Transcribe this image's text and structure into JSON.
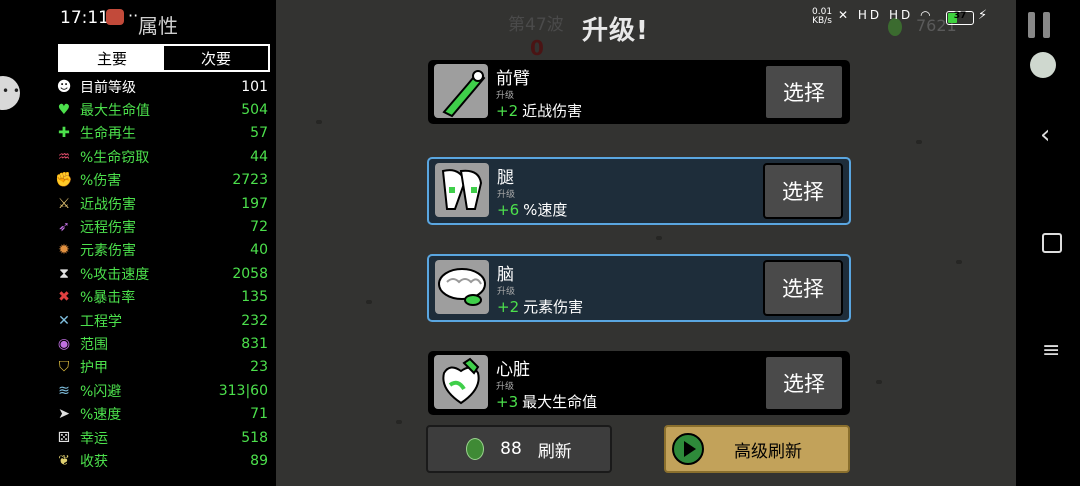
{
  "status_bar": {
    "time": "17:11",
    "more": "··",
    "net_speed": "0.01\nKB/s",
    "signal": "HD HD",
    "battery": "37"
  },
  "hud": {
    "wave": "第47波",
    "wave_counter": "0",
    "level_up_title": "升级!",
    "materials": "7621"
  },
  "stats_panel": {
    "title": "属性",
    "tabs": {
      "primary": "主要",
      "secondary": "次要"
    },
    "stats": [
      {
        "icon": "level-icon",
        "glyph": "☻",
        "color": "#ffffff",
        "name": "目前等级",
        "value": "101",
        "green": false
      },
      {
        "icon": "heart-icon",
        "glyph": "♥",
        "color": "#4ce04c",
        "name": "最大生命值",
        "value": "504",
        "green": true
      },
      {
        "icon": "regen-icon",
        "glyph": "✚",
        "color": "#4ce04c",
        "name": "生命再生",
        "value": "57",
        "green": true
      },
      {
        "icon": "lifesteal-icon",
        "glyph": "♒",
        "color": "#e04c6a",
        "name": "%生命窃取",
        "value": "44",
        "green": true
      },
      {
        "icon": "damage-icon",
        "glyph": "✊",
        "color": "#e05050",
        "name": "%伤害",
        "value": "2723",
        "green": true
      },
      {
        "icon": "melee-icon",
        "glyph": "⚔",
        "color": "#e0c070",
        "name": "近战伤害",
        "value": "197",
        "green": true
      },
      {
        "icon": "ranged-icon",
        "glyph": "➶",
        "color": "#c070e0",
        "name": "远程伤害",
        "value": "72",
        "green": true
      },
      {
        "icon": "elemental-icon",
        "glyph": "✹",
        "color": "#e09040",
        "name": "元素伤害",
        "value": "40",
        "green": true
      },
      {
        "icon": "attack-speed-icon",
        "glyph": "⧗",
        "color": "#e0e0e0",
        "name": "%攻击速度",
        "value": "2058",
        "green": true
      },
      {
        "icon": "crit-icon",
        "glyph": "✖",
        "color": "#e04040",
        "name": "%暴击率",
        "value": "135",
        "green": true
      },
      {
        "icon": "engineering-icon",
        "glyph": "✕",
        "color": "#80c0e0",
        "name": "工程学",
        "value": "232",
        "green": true
      },
      {
        "icon": "range-icon",
        "glyph": "◉",
        "color": "#c070e0",
        "name": "范围",
        "value": "831",
        "green": true
      },
      {
        "icon": "armor-icon",
        "glyph": "⛉",
        "color": "#e0c040",
        "name": "护甲",
        "value": "23",
        "green": true
      },
      {
        "icon": "dodge-icon",
        "glyph": "≋",
        "color": "#80c0e0",
        "name": "%闪避",
        "value": "313|60",
        "green": true
      },
      {
        "icon": "speed-icon",
        "glyph": "➤",
        "color": "#e0e0e0",
        "name": "%速度",
        "value": "71",
        "green": true
      },
      {
        "icon": "luck-icon",
        "glyph": "⚄",
        "color": "#e0e0e0",
        "name": "幸运",
        "value": "518",
        "green": true
      },
      {
        "icon": "harvest-icon",
        "glyph": "❦",
        "color": "#e0d070",
        "name": "收获",
        "value": "89",
        "green": true
      }
    ]
  },
  "upgrades": [
    {
      "name": "前臂",
      "type": "升级",
      "bonus": "+2",
      "effect": "近战伤害",
      "select": "选择",
      "icon": "forearm-icon",
      "highlighted": false
    },
    {
      "name": "腿",
      "type": "升级",
      "bonus": "+6",
      "effect": "%速度",
      "select": "选择",
      "icon": "legs-icon",
      "highlighted": true
    },
    {
      "name": "脑",
      "type": "升级",
      "bonus": "+2",
      "effect": "元素伤害",
      "select": "选择",
      "icon": "brain-icon",
      "highlighted": true
    },
    {
      "name": "心脏",
      "type": "升级",
      "bonus": "+3",
      "effect": "最大生命值",
      "select": "选择",
      "icon": "heart-organ-icon",
      "highlighted": false
    }
  ],
  "reroll": {
    "price": "88",
    "label": "刷新"
  },
  "premium_reroll": {
    "label": "高级刷新"
  }
}
